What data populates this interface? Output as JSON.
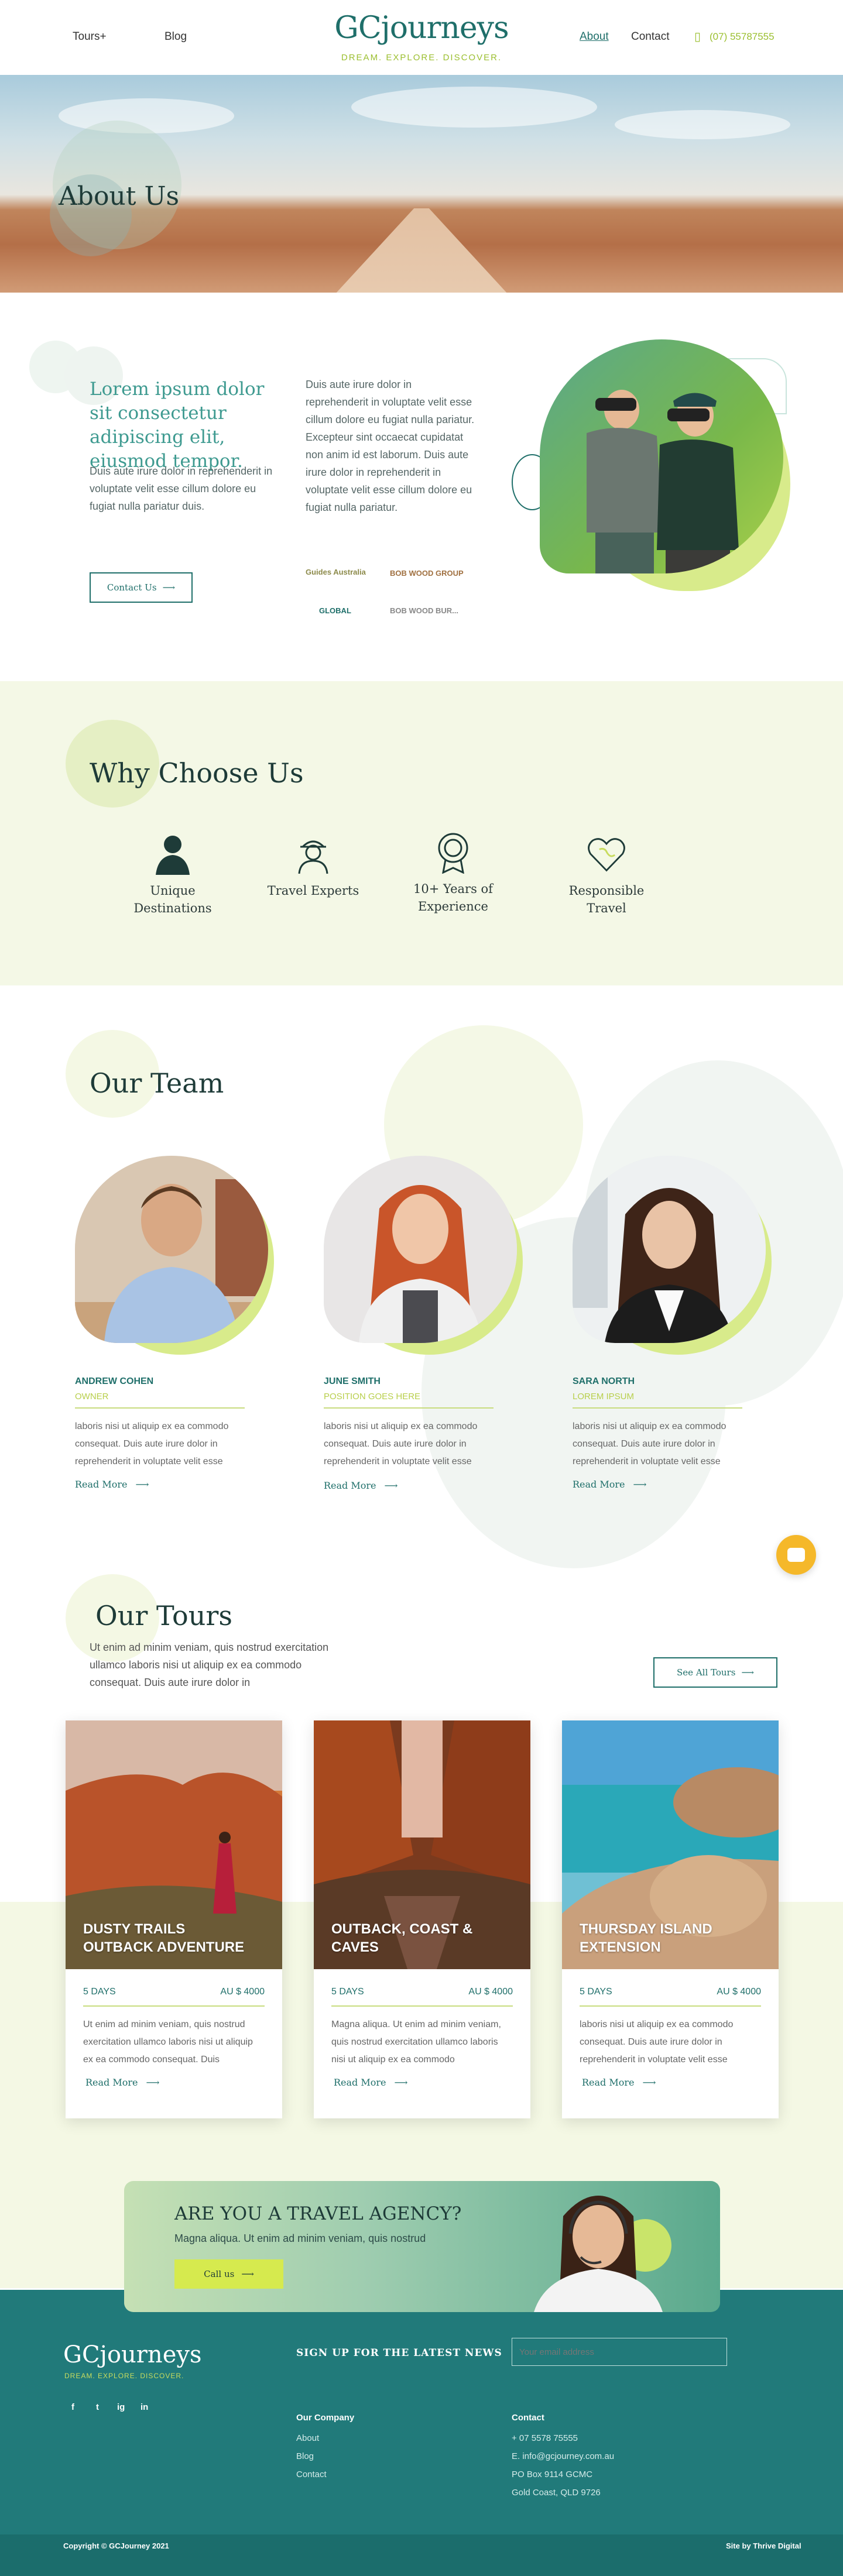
{
  "header": {
    "nav_left": [
      {
        "label": "Tours+"
      },
      {
        "label": "Blog"
      }
    ],
    "logo_text": "GCjourneys",
    "logo_tagline": "DREAM. EXPLORE. DISCOVER.",
    "nav_right": [
      {
        "label": "About"
      },
      {
        "label": "Contact"
      }
    ],
    "phone": "(07) 55787555",
    "colors": {
      "primary": "#1f6f6a",
      "accent": "#9bbf2f"
    }
  },
  "hero": {
    "title": "About Us"
  },
  "intro": {
    "heading": "Lorem ipsum dolor sit consectetur adipiscing elit, eiusmod tempor.",
    "text_left": "Duis aute irure dolor in reprehenderit in voluptate velit esse cillum dolore eu fugiat nulla pariatur duis.",
    "text_right": "Duis aute irure dolor in reprehenderit in voluptate velit esse cillum dolore eu fugiat nulla pariatur. Excepteur sint occaecat cupidatat non anim id est laborum. Duis aute irure dolor in reprehenderit in voluptate velit esse cillum dolore eu fugiat nulla pariatur.",
    "button": "Contact Us",
    "partners": [
      "Guides Australia",
      "BOB WOOD GROUP",
      "GLOBAL",
      "BOB WOOD BUR..."
    ]
  },
  "why": {
    "title": "Why Choose Us",
    "features": [
      {
        "label": "Unique Destinations",
        "icon": "person-icon"
      },
      {
        "label": "Travel Experts",
        "icon": "guide-icon"
      },
      {
        "label": "10+ Years of Experience",
        "icon": "award-icon"
      },
      {
        "label": "Responsible Travel",
        "icon": "heart-globe-icon"
      }
    ]
  },
  "team": {
    "title": "Our Team",
    "members": [
      {
        "name": "ANDREW COHEN",
        "role": "OWNER",
        "text": "laboris nisi ut aliquip ex ea commodo consequat. Duis aute irure dolor in reprehenderit in voluptate velit esse",
        "link": "Read More"
      },
      {
        "name": "JUNE SMITH",
        "role": "POSITION GOES HERE",
        "text": "laboris nisi ut aliquip ex ea commodo consequat. Duis aute irure dolor in reprehenderit in voluptate velit esse",
        "link": "Read More"
      },
      {
        "name": "SARA NORTH",
        "role": "LOREM IPSUM",
        "text": "laboris nisi ut aliquip ex ea commodo consequat. Duis aute irure dolor in reprehenderit in voluptate velit esse",
        "link": "Read More"
      }
    ]
  },
  "tours": {
    "title": "Our Tours",
    "intro": "Ut enim ad minim veniam, quis nostrud exercitation ullamco laboris nisi ut aliquip ex ea commodo consequat. Duis aute irure dolor in",
    "see_all": "See All Tours",
    "cards": [
      {
        "title": "DUSTY TRAILS OUTBACK ADVENTURE",
        "days": "5 DAYS",
        "price": "AU $ 4000",
        "text": "Ut enim ad minim veniam, quis nostrud exercitation ullamco laboris nisi ut aliquip ex ea commodo consequat. Duis",
        "link": "Read More"
      },
      {
        "title": "OUTBACK, COAST & CAVES",
        "days": "5 DAYS",
        "price": "AU $ 4000",
        "text": "Magna aliqua. Ut enim ad minim veniam, quis nostrud exercitation ullamco laboris nisi ut aliquip ex ea commodo",
        "link": "Read More"
      },
      {
        "title": "THURSDAY ISLAND EXTENSION",
        "days": "5 DAYS",
        "price": "AU $ 4000",
        "text": "laboris nisi ut aliquip ex ea commodo consequat. Duis aute irure dolor in reprehenderit in voluptate velit esse",
        "link": "Read More"
      }
    ]
  },
  "agency": {
    "title": "ARE YOU A TRAVEL AGENCY?",
    "text": "Magna aliqua. Ut enim ad minim veniam, quis nostrud",
    "button": "Call us"
  },
  "footer": {
    "logo_text": "GCjourneys",
    "logo_tagline": "DREAM. EXPLORE. DISCOVER.",
    "social": [
      "f",
      "t",
      "ig",
      "in"
    ],
    "newsletter_title": "SIGN UP FOR THE LATEST NEWS",
    "email_placeholder": "Your email address",
    "company_title": "Our Company",
    "company_links": [
      "About",
      "Blog",
      "Contact"
    ],
    "contact_title": "Contact",
    "contact_lines": [
      "+ 07 5578 75555",
      "E. info@gcjourney.com.au",
      "PO Box 9114 GCMC",
      "Gold Coast, QLD 9726"
    ],
    "copyright": "Copyright © GCJourney 2021",
    "credit": "Site by Thrive Digital"
  }
}
